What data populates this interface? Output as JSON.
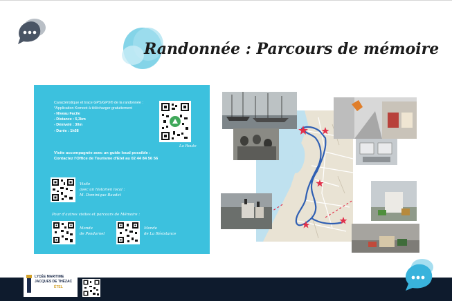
{
  "slide": {
    "title": "Randonnée : Parcours de mémoire"
  },
  "panel": {
    "header": "Caractéristique et trace GPS/GPX® de la randonnée :",
    "items": [
      "*Application Komoot à télécharger gratuitement",
      "- Niveau Facile",
      "- Distance : 5,3km",
      "- Dénivelé : 30m",
      "- Durée : 1h58"
    ],
    "qr_route_caption": "La Route",
    "guide_line1": "Visite accompagnée avec un guide local possible :",
    "guide_line2": "Contactez l'Office de Tourisme d'Etel au 02 44 84 56 56",
    "historian_line1": "Visite",
    "historian_line2": "avec un historien local :",
    "historian_line3": "M. Dominique Baudet",
    "other_visits": "Pour d'autres visites et parcours de Mémoire :",
    "qr_a_line1": "Monde",
    "qr_a_line2": "de Pondarnel",
    "qr_b_line1": "Monde",
    "qr_b_line2": "de La Résistance"
  },
  "logo": {
    "line1": "LYCÉE MARITIME",
    "line2": "JACQUES DE THÉZAC",
    "line3": "ÉTEL"
  },
  "colors": {
    "panel": "#3cc1de",
    "bubble_dark": "#4a5565",
    "bubble_light": "#5fc3e0",
    "bottom_bar": "#0e1b2d",
    "route_line": "#2f5fb3",
    "marker": "#e2304a"
  },
  "icons": [
    "chat-bubble-icon",
    "qr-code-icon",
    "map-marker-icon",
    "campaign-logo-icon"
  ]
}
